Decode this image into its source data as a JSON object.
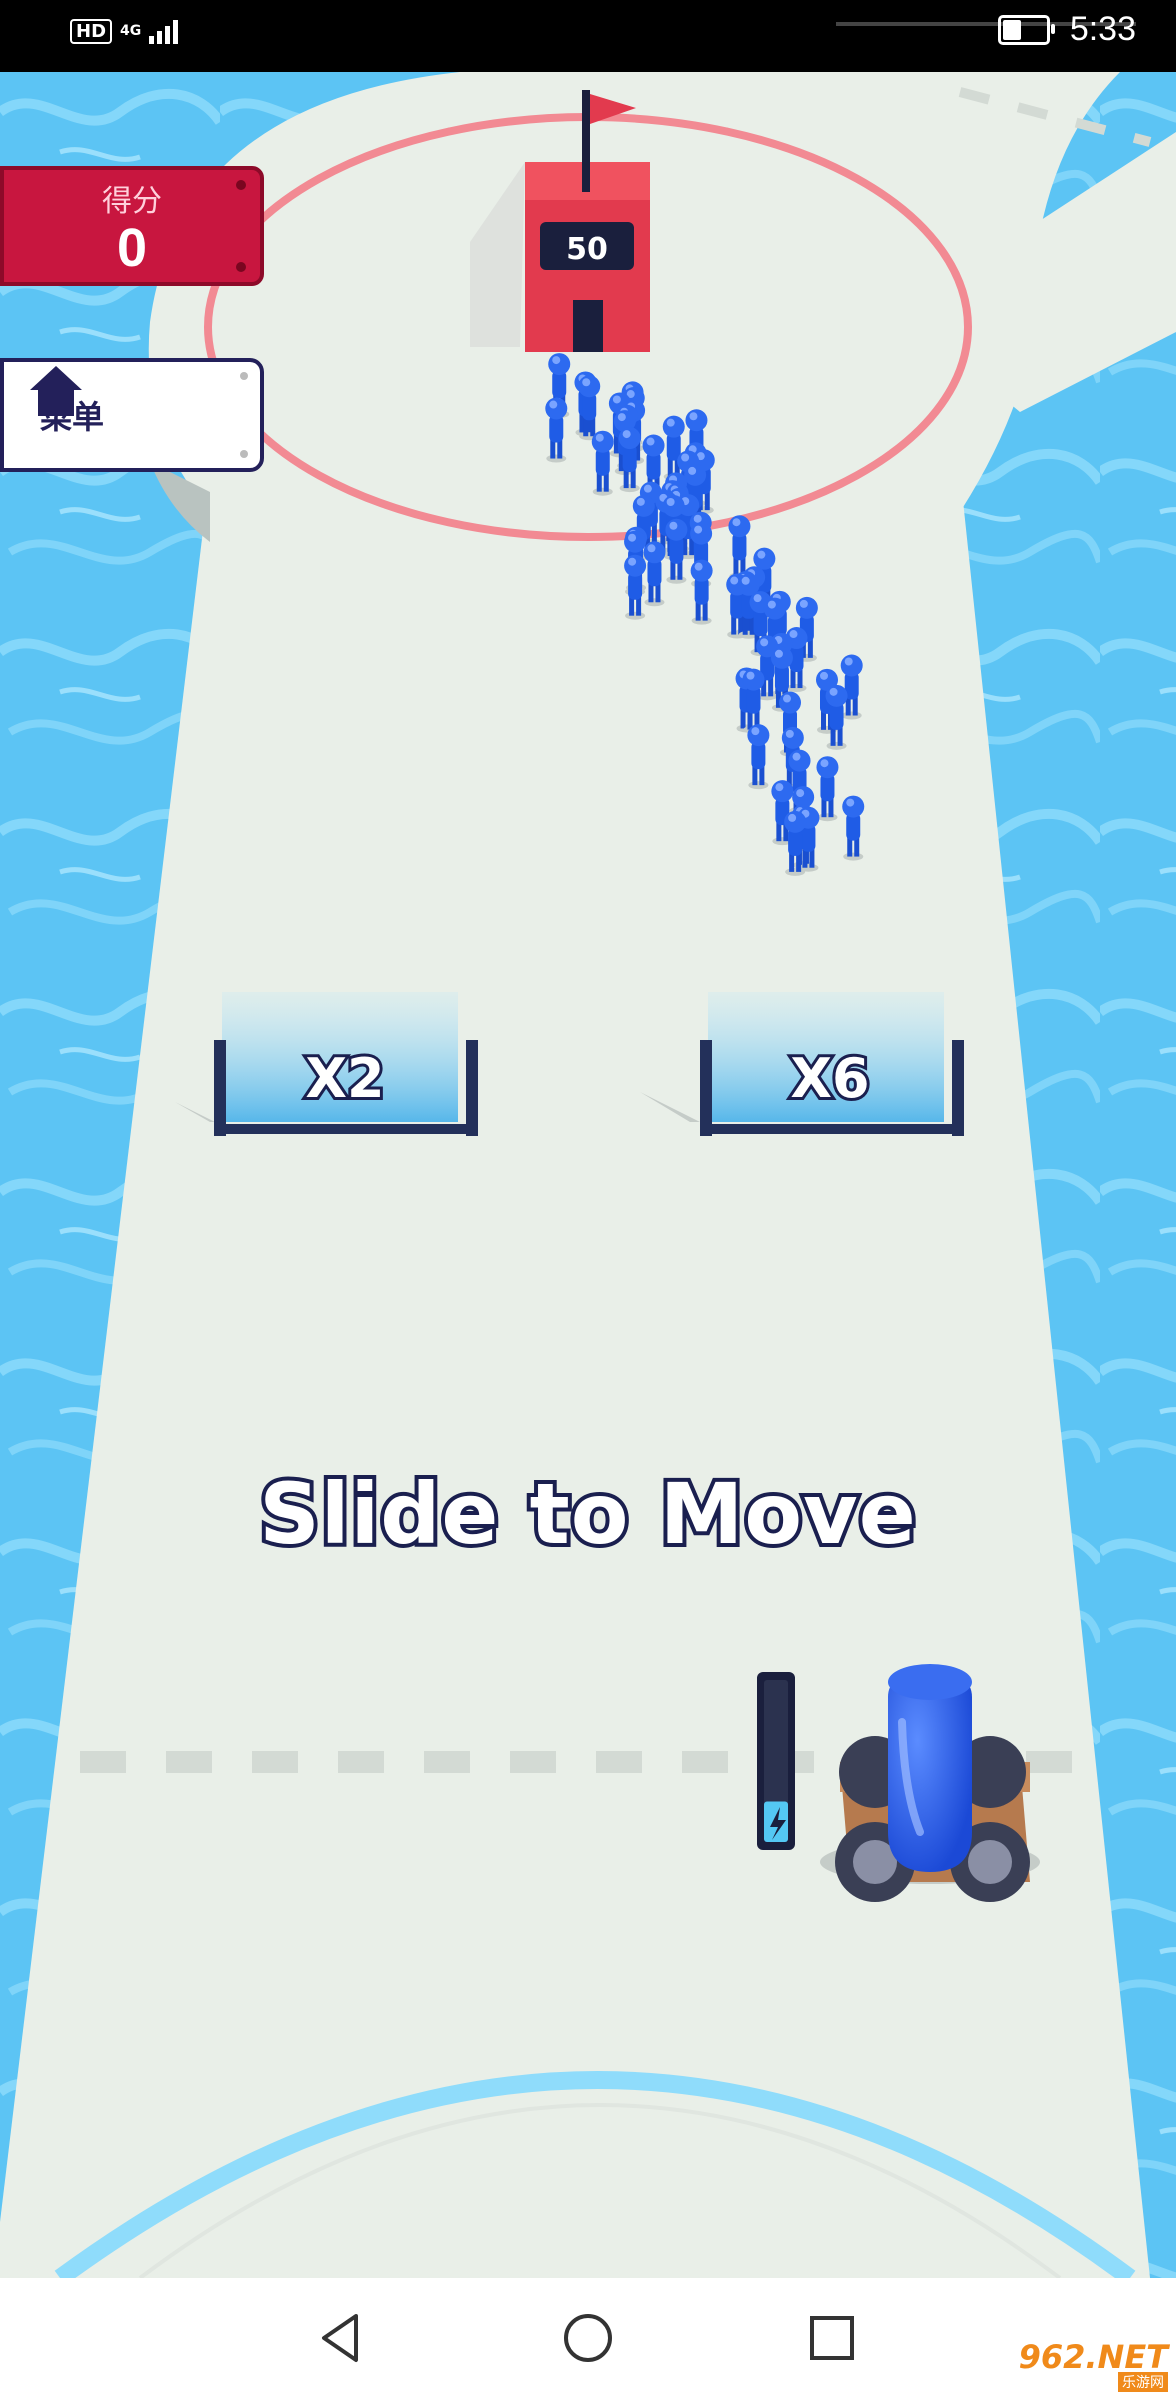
{
  "status_bar": {
    "hd": "HD",
    "network": "4G",
    "time": "5:33",
    "battery_level": 0.45
  },
  "hud": {
    "score_label": "得分",
    "score_value": "0",
    "menu_label": "菜单"
  },
  "tower": {
    "count": "50"
  },
  "gates": [
    {
      "label": "X2"
    },
    {
      "label": "X6"
    }
  ],
  "hint": "Slide to Move",
  "cannon": {
    "charge_level": 0.25
  },
  "watermark": {
    "main": "962.NET",
    "sub": "乐游网"
  },
  "colors": {
    "water": "#5cc4f4",
    "track": "#e9efe8",
    "crowd": "#1f5ce6",
    "tower": "#e23a4e",
    "ring": "#f28a93"
  },
  "icons": {
    "menu": "home-icon",
    "nav_back": "back-triangle-icon",
    "nav_home": "home-circle-icon",
    "nav_recents": "recents-square-icon",
    "cannon_charge": "lightning-icon"
  }
}
